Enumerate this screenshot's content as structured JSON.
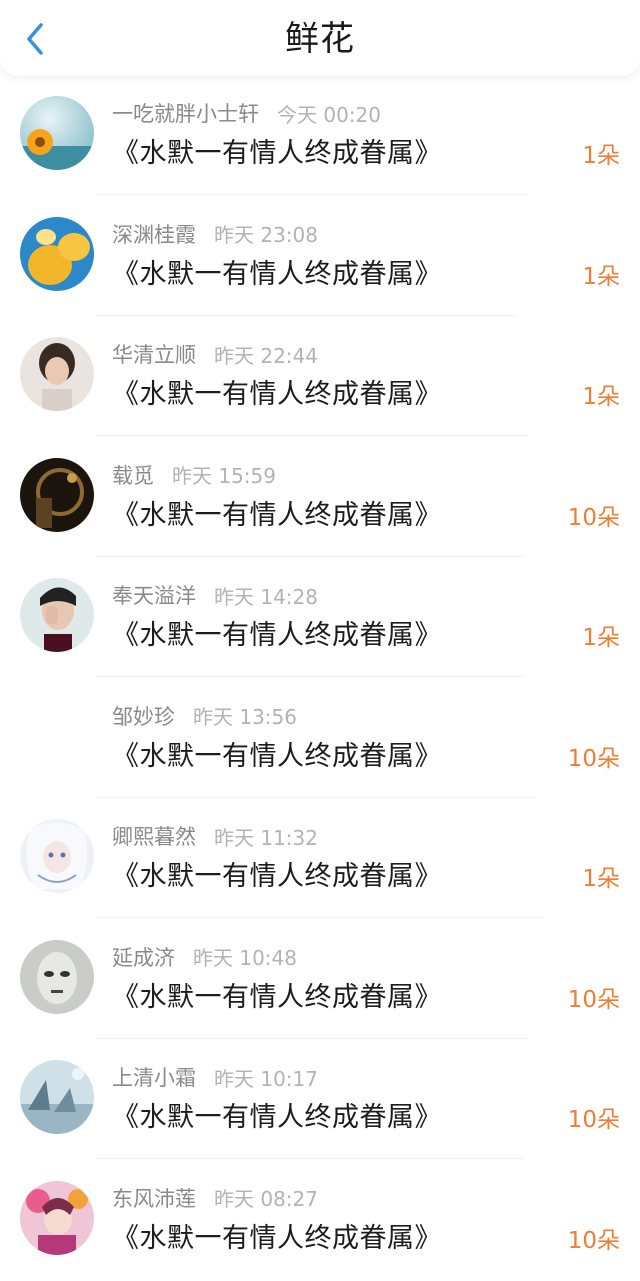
{
  "header": {
    "title": "鲜花",
    "back_icon": "chevron-left-icon",
    "accent": "#3a8ee6"
  },
  "book_title": "《水默一有情人终成眷属》",
  "items": [
    {
      "name": "一吃就胖小士轩",
      "time": "今天 00:20",
      "count": "1朵",
      "avatar": "flower"
    },
    {
      "name": "深渊桂霞",
      "time": "昨天 23:08",
      "count": "1朵",
      "avatar": "food"
    },
    {
      "name": "华清立顺",
      "time": "昨天 22:44",
      "count": "1朵",
      "avatar": "girl"
    },
    {
      "name": "载觅",
      "time": "昨天 15:59",
      "count": "10朵",
      "avatar": "dark-room"
    },
    {
      "name": "奉天溢洋",
      "time": "昨天 14:28",
      "count": "1朵",
      "avatar": "man-hand"
    },
    {
      "name": "邹妙珍",
      "time": "昨天 13:56",
      "count": "10朵",
      "avatar": "none"
    },
    {
      "name": "卿熙暮然",
      "time": "昨天 11:32",
      "count": "1朵",
      "avatar": "anime-white"
    },
    {
      "name": "延成济",
      "time": "昨天 10:48",
      "count": "10朵",
      "avatar": "face-bw"
    },
    {
      "name": "上清小霜",
      "time": "昨天 10:17",
      "count": "10朵",
      "avatar": "winter"
    },
    {
      "name": "东风沛莲",
      "time": "昨天 08:27",
      "count": "10朵",
      "avatar": "anime-colorful"
    }
  ],
  "colors": {
    "count": "#ee7d35",
    "name": "#8a8a8a",
    "time": "#b3b3b3"
  }
}
